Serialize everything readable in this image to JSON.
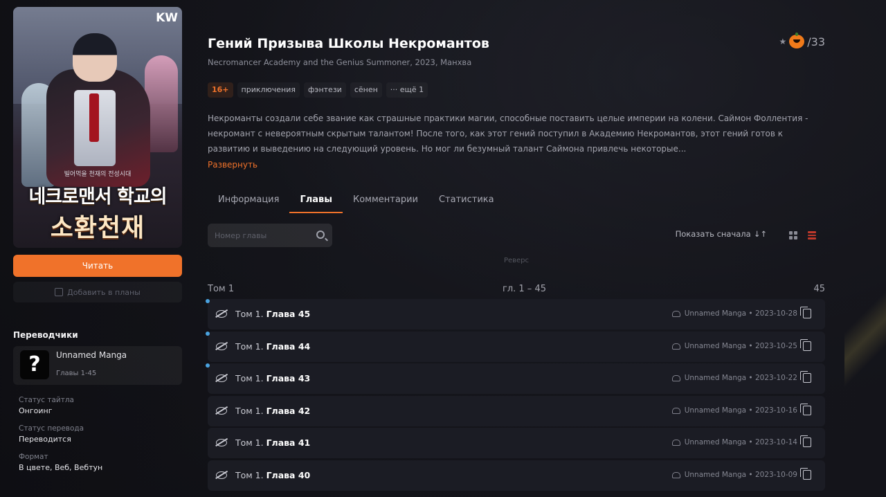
{
  "cover": {
    "badge": "KW",
    "subtitle_ko": "빌어먹을 천재의 전성시대",
    "title_ko_line1": "네크로맨서 학교의",
    "title_ko_line2": "소환천재"
  },
  "actions": {
    "read_label": "Читать",
    "plans_label": "Добавить в планы"
  },
  "translators": {
    "heading": "Переводчики",
    "team": {
      "name": "Unnamed Manga",
      "chapters": "Главы 1-45",
      "avatar_glyph": "?"
    }
  },
  "meta": [
    {
      "label": "Статус тайтла",
      "value": "Онгоинг"
    },
    {
      "label": "Статус перевода",
      "value": "Переводится"
    },
    {
      "label": "Формат",
      "value": "В цвете, Веб, Вебтун"
    }
  ],
  "title": {
    "main": "Гений Призыва Школы Некромантов",
    "alt": "Necromancer Academy and the Genius Summoner, 2023, Манхва",
    "rating_score": "/33",
    "rating_star": "★"
  },
  "tags": [
    {
      "label": "16+",
      "age": true
    },
    {
      "label": "приключения"
    },
    {
      "label": "фэнтези"
    },
    {
      "label": "сёнен"
    },
    {
      "label": "··· ещё 1"
    }
  ],
  "description": {
    "text": "Некроманты создали себе звание как страшные практики магии, способные поставить целые империи на колени. Саймон Фоллентия - некромант с невероятным скрытым талантом! После того, как этот гений поступил в Академию Некромантов, этот гений готов к развитию и выведению на следующий уровень. Но мог ли безумный талант Саймона привлечь некоторые...",
    "expand_label": "Развернуть"
  },
  "tabs": [
    {
      "label": "Информация",
      "active": false
    },
    {
      "label": "Главы",
      "active": true
    },
    {
      "label": "Комментарии",
      "active": false
    },
    {
      "label": "Статистика",
      "active": false
    }
  ],
  "toolbar": {
    "search_placeholder": "Номер главы",
    "sort_label": "Показать сначала",
    "sort_arrow": "↓↑",
    "reverse_label": "Реверс"
  },
  "volume": {
    "name": "Том 1",
    "range": "гл. 1 – 45",
    "count": "45"
  },
  "chapters": [
    {
      "prefix": "Том 1. ",
      "name": "Глава 45",
      "team": "Unnamed Manga",
      "date": "2023-10-28",
      "new": true
    },
    {
      "prefix": "Том 1. ",
      "name": "Глава 44",
      "team": "Unnamed Manga",
      "date": "2023-10-25",
      "new": true
    },
    {
      "prefix": "Том 1. ",
      "name": "Глава 43",
      "team": "Unnamed Manga",
      "date": "2023-10-22",
      "new": true
    },
    {
      "prefix": "Том 1. ",
      "name": "Глава 42",
      "team": "Unnamed Manga",
      "date": "2023-10-16",
      "new": false
    },
    {
      "prefix": "Том 1. ",
      "name": "Глава 41",
      "team": "Unnamed Manga",
      "date": "2023-10-14",
      "new": false
    },
    {
      "prefix": "Том 1. ",
      "name": "Глава 40",
      "team": "Unnamed Manga",
      "date": "2023-10-09",
      "new": false
    }
  ],
  "colors": {
    "accent": "#f0722a",
    "new_dot": "#4aa3e0",
    "background": "#121217"
  }
}
